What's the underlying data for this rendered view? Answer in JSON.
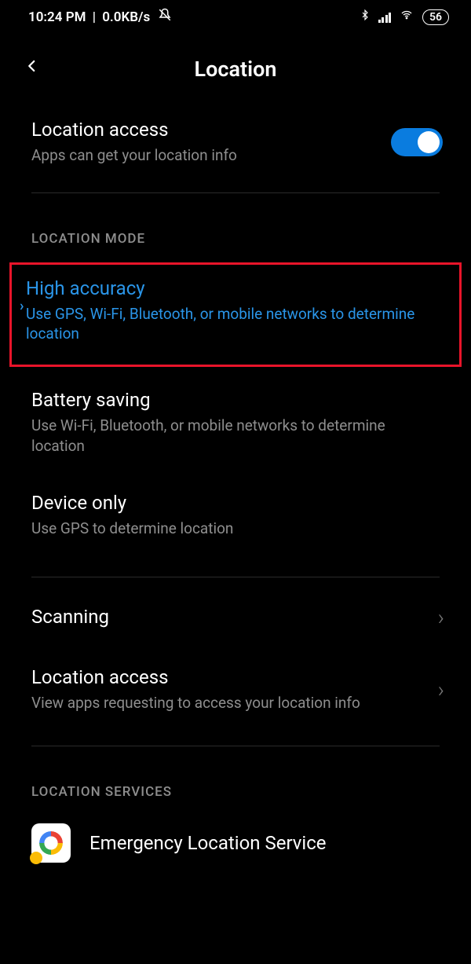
{
  "status": {
    "time": "10:24 PM",
    "speed": "0.0KB/s",
    "battery": "56"
  },
  "header": {
    "title": "Location"
  },
  "location_access": {
    "title": "Location access",
    "subtitle": "Apps can get your location info"
  },
  "sections": {
    "mode_label": "LOCATION MODE",
    "services_label": "LOCATION SERVICES"
  },
  "modes": {
    "high": {
      "title": "High accuracy",
      "subtitle": "Use GPS, Wi-Fi, Bluetooth, or mobile networks to determine location"
    },
    "battery": {
      "title": "Battery saving",
      "subtitle": "Use Wi-Fi, Bluetooth, or mobile networks to determine location"
    },
    "device": {
      "title": "Device only",
      "subtitle": "Use GPS to determine location"
    }
  },
  "scanning": {
    "title": "Scanning"
  },
  "access_apps": {
    "title": "Location access",
    "subtitle": "View apps requesting to access your location info"
  },
  "services": {
    "emergency": "Emergency Location Service"
  }
}
